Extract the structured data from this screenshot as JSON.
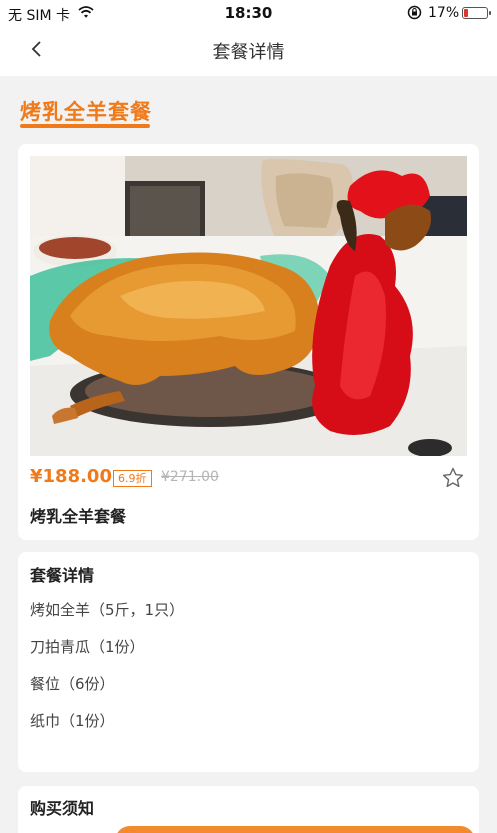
{
  "status_bar": {
    "carrier": "无 SIM 卡",
    "time": "18:30",
    "battery_percent": "17%",
    "battery_level": 0.17,
    "icons": [
      "wifi-icon",
      "orientation-lock-icon",
      "battery-icon"
    ]
  },
  "nav": {
    "title": "套餐详情",
    "back_icon": "chevron-left-icon"
  },
  "section": {
    "title": "烤乳全羊套餐"
  },
  "product": {
    "price": "¥188.00",
    "discount": "6.9折",
    "original_price": "¥271.00",
    "name": "烤乳全羊套餐",
    "favorite_icon": "star-outline-icon"
  },
  "detail": {
    "title": "套餐详情",
    "items": [
      "烤如全羊（5斤，1只）",
      "刀拍青瓜（1份）",
      "餐位（6份）",
      "纸巾（1份）"
    ]
  },
  "notice": {
    "title": "购买须知"
  },
  "colors": {
    "accent": "#f07a1a",
    "background": "#f2f2f2",
    "battery_low": "#e0342b"
  }
}
